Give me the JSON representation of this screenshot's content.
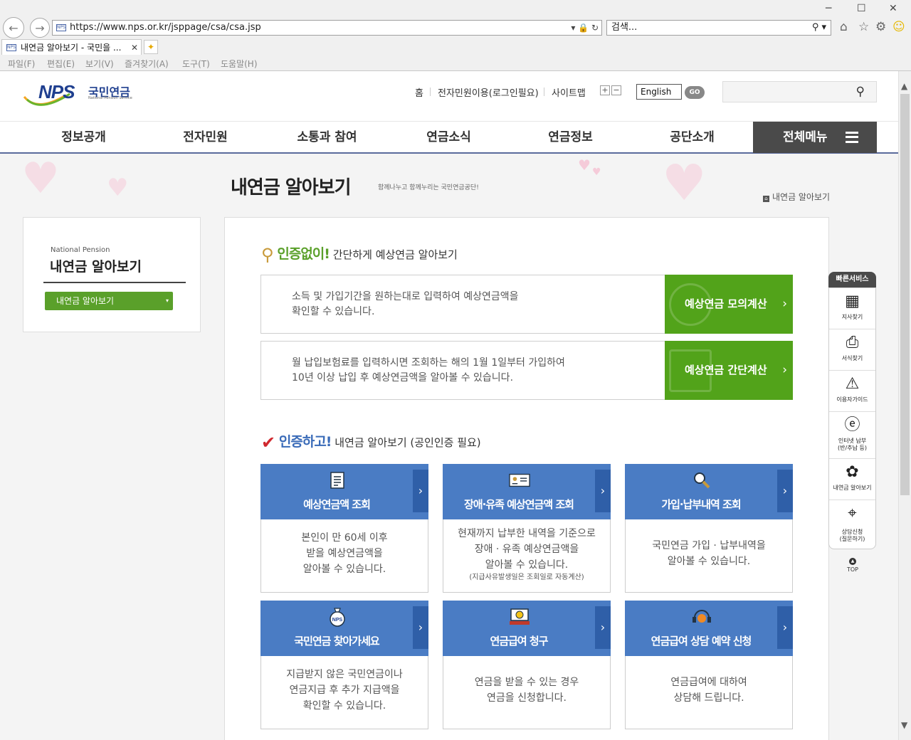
{
  "browser": {
    "url": "https://www.nps.or.kr/jsppage/csa/csa.jsp",
    "search_placeholder": "검색...",
    "tab_title": "내연금 알아보기 - 국민을 ...",
    "menu": [
      "파일(F)",
      "편집(E)",
      "보기(V)",
      "즐겨찾기(A)",
      "도구(T)",
      "도움말(H)"
    ]
  },
  "header": {
    "logo_mark": "NPS",
    "logo_kr": "국민연금",
    "logo_en": "National Pension Service",
    "util": [
      "홈",
      "전자민원이용(로그인필요)",
      "사이트맵"
    ],
    "lang": "English",
    "go": "GO"
  },
  "gnb": [
    "정보공개",
    "전자민원",
    "소통과 참여",
    "연금소식",
    "연금정보",
    "공단소개"
  ],
  "all_menu": "전체메뉴",
  "page": {
    "title": "내연금 알아보기",
    "subtitle": "함께나누고 함께누리는 국민연금공단!",
    "breadcrumb": "내연금 알아보기"
  },
  "lnb": {
    "eyebrow": "National Pension",
    "title": "내연금 알아보기",
    "selected": "내연금 알아보기"
  },
  "section1": {
    "strong": "인증없이!",
    "rest": " 간단하게 예상연금 알아보기",
    "boxes": [
      {
        "desc1": "소득 및 가입기간을 원하는대로 입력하여 예상연금액을",
        "desc2": "확인할 수 있습니다.",
        "btn": "예상연금 모의계산"
      },
      {
        "desc1": "월 납입보험료를 입력하시면 조회하는 해의 1월 1일부터 가입하여",
        "desc2": "10년 이상 납입 후 예상연금액을 알아볼 수 있습니다.",
        "btn": "예상연금 간단계산"
      }
    ]
  },
  "section2": {
    "strong": "인증하고!",
    "rest": " 내연금 알아보기 (공인인증 필요)",
    "cards": [
      {
        "title": "예상연금액 조회",
        "l1": "본인이 만 60세 이후",
        "l2": "받을 예상연금액을",
        "l3": "알아볼 수 있습니다.",
        "note": ""
      },
      {
        "title": "장애·유족 예상연금액 조회",
        "l1": "현재까지 납부한 내역을 기준으로",
        "l2": "장애 · 유족 예상연금액을",
        "l3": "알아볼 수 있습니다.",
        "note": "(지급사유발생일은 조회일로 자동계산)"
      },
      {
        "title": "가입·납부내역 조회",
        "l1": "국민연금 가입 · 납부내역을",
        "l2": "알아볼 수 있습니다.",
        "l3": "",
        "note": ""
      },
      {
        "title": "국민연금 찾아가세요",
        "l1": "지급받지 않은 국민연금이나",
        "l2": "연금지급 후 추가 지급액을",
        "l3": "확인할 수 있습니다.",
        "note": ""
      },
      {
        "title": "연금급여 청구",
        "l1": "연금을 받을 수 있는 경우",
        "l2": "연금을 신청합니다.",
        "l3": "",
        "note": ""
      },
      {
        "title": "연금급여 상담 예약 신청",
        "l1": "연금급여에 대하여",
        "l2": "상담해 드립니다.",
        "l3": "",
        "note": ""
      }
    ]
  },
  "quick": {
    "header": "빠른서비스",
    "items": [
      {
        "l1": "지사찾기",
        "l2": ""
      },
      {
        "l1": "서식찾기",
        "l2": ""
      },
      {
        "l1": "이용자가이드",
        "l2": ""
      },
      {
        "l1": "인터넷 납부",
        "l2": "(반/추납 등)"
      },
      {
        "l1": "내연금 알아보기",
        "l2": ""
      },
      {
        "l1": "상담신청",
        "l2": "(질문하기)"
      }
    ],
    "top": "TOP"
  }
}
